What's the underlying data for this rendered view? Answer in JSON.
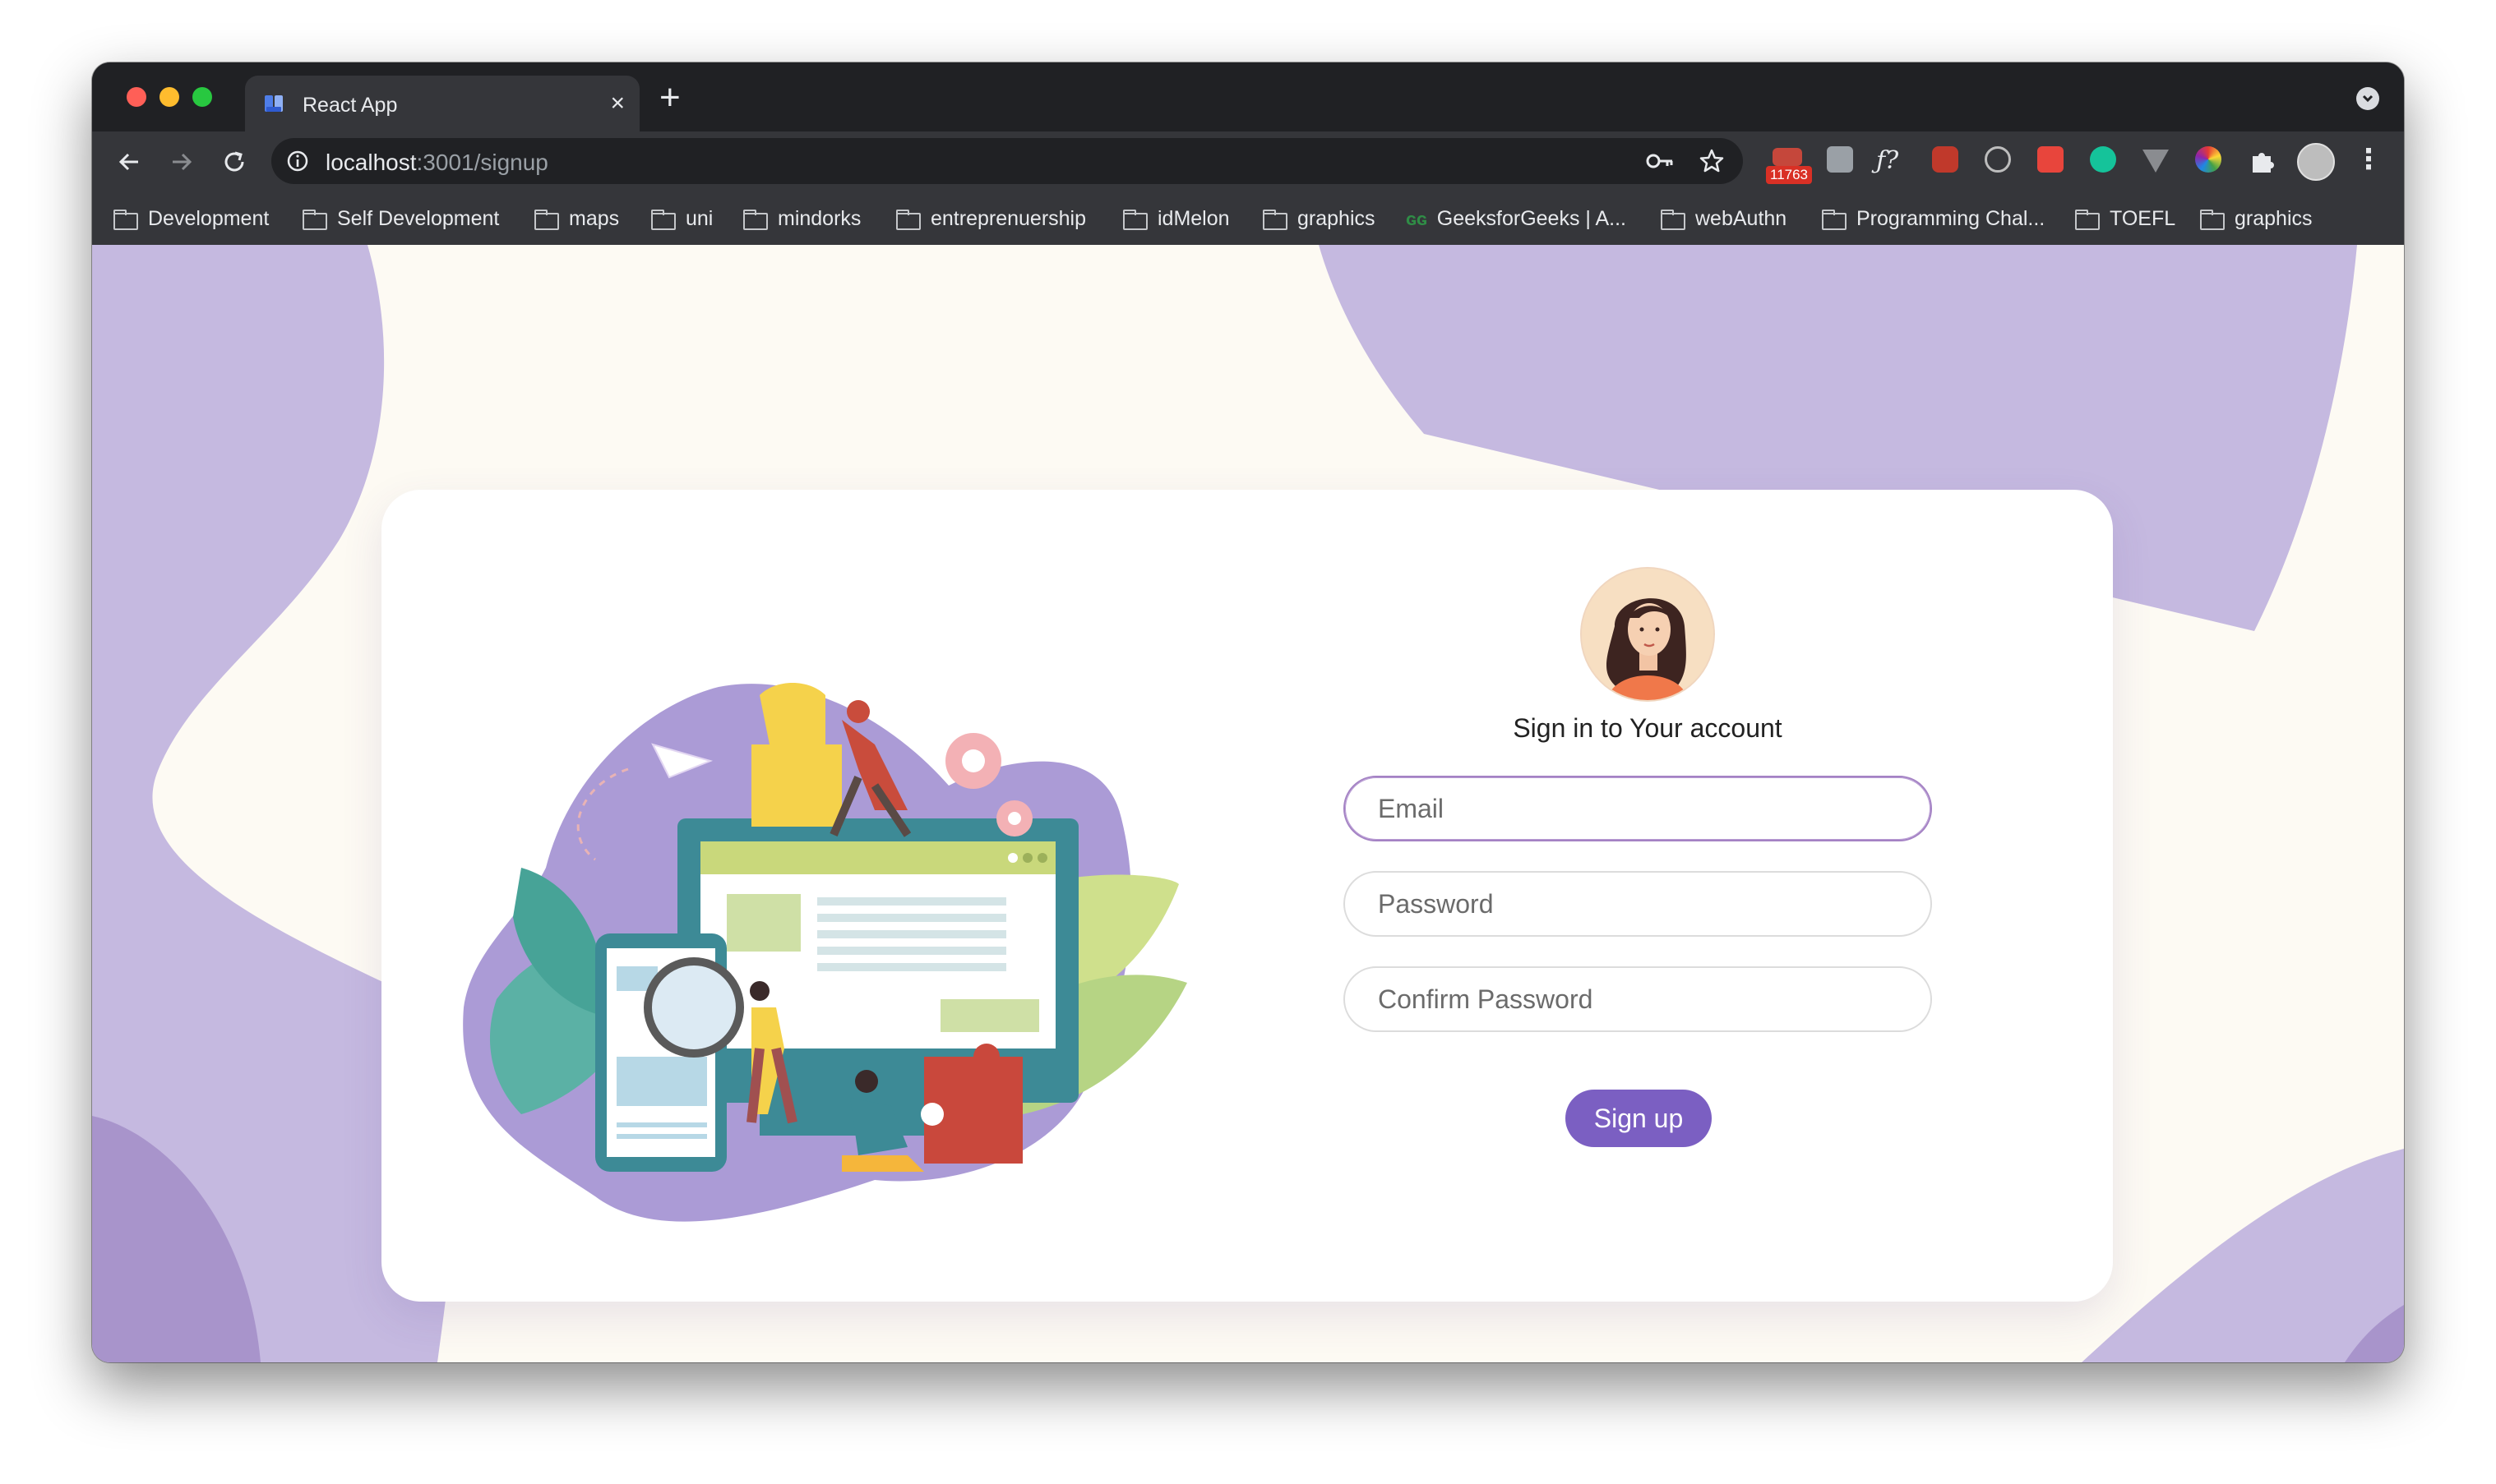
{
  "browser": {
    "tab_title": "React App",
    "tab_close": "×",
    "new_tab": "+",
    "url_host": "localhost",
    "url_rest": ":3001/signup",
    "extension_badge": "11763",
    "menu": "⋮",
    "bookmarks": [
      {
        "label": "Development",
        "icon": "folder-icon"
      },
      {
        "label": "Self Development",
        "icon": "folder-icon"
      },
      {
        "label": "maps",
        "icon": "folder-icon"
      },
      {
        "label": "uni",
        "icon": "folder-icon"
      },
      {
        "label": "mindorks",
        "icon": "folder-icon"
      },
      {
        "label": "entreprenuership",
        "icon": "folder-icon"
      },
      {
        "label": "idMelon",
        "icon": "folder-icon"
      },
      {
        "label": "graphics",
        "icon": "folder-icon"
      },
      {
        "label": "GeeksforGeeks | A...",
        "icon": "gfg-icon"
      },
      {
        "label": "webAuthn",
        "icon": "folder-icon"
      },
      {
        "label": "Programming Chal...",
        "icon": "folder-icon"
      },
      {
        "label": "TOEFL",
        "icon": "folder-icon"
      },
      {
        "label": "graphics",
        "icon": "folder-icon"
      }
    ]
  },
  "signup": {
    "title": "Sign in to Your account",
    "email_placeholder": "Email",
    "password_placeholder": "Password",
    "confirm_placeholder": "Confirm Password",
    "submit_label": "Sign up"
  },
  "colors": {
    "accent": "#7b5fc2",
    "blob": "#c5b9e0",
    "page_bg": "#fdfaf3"
  }
}
